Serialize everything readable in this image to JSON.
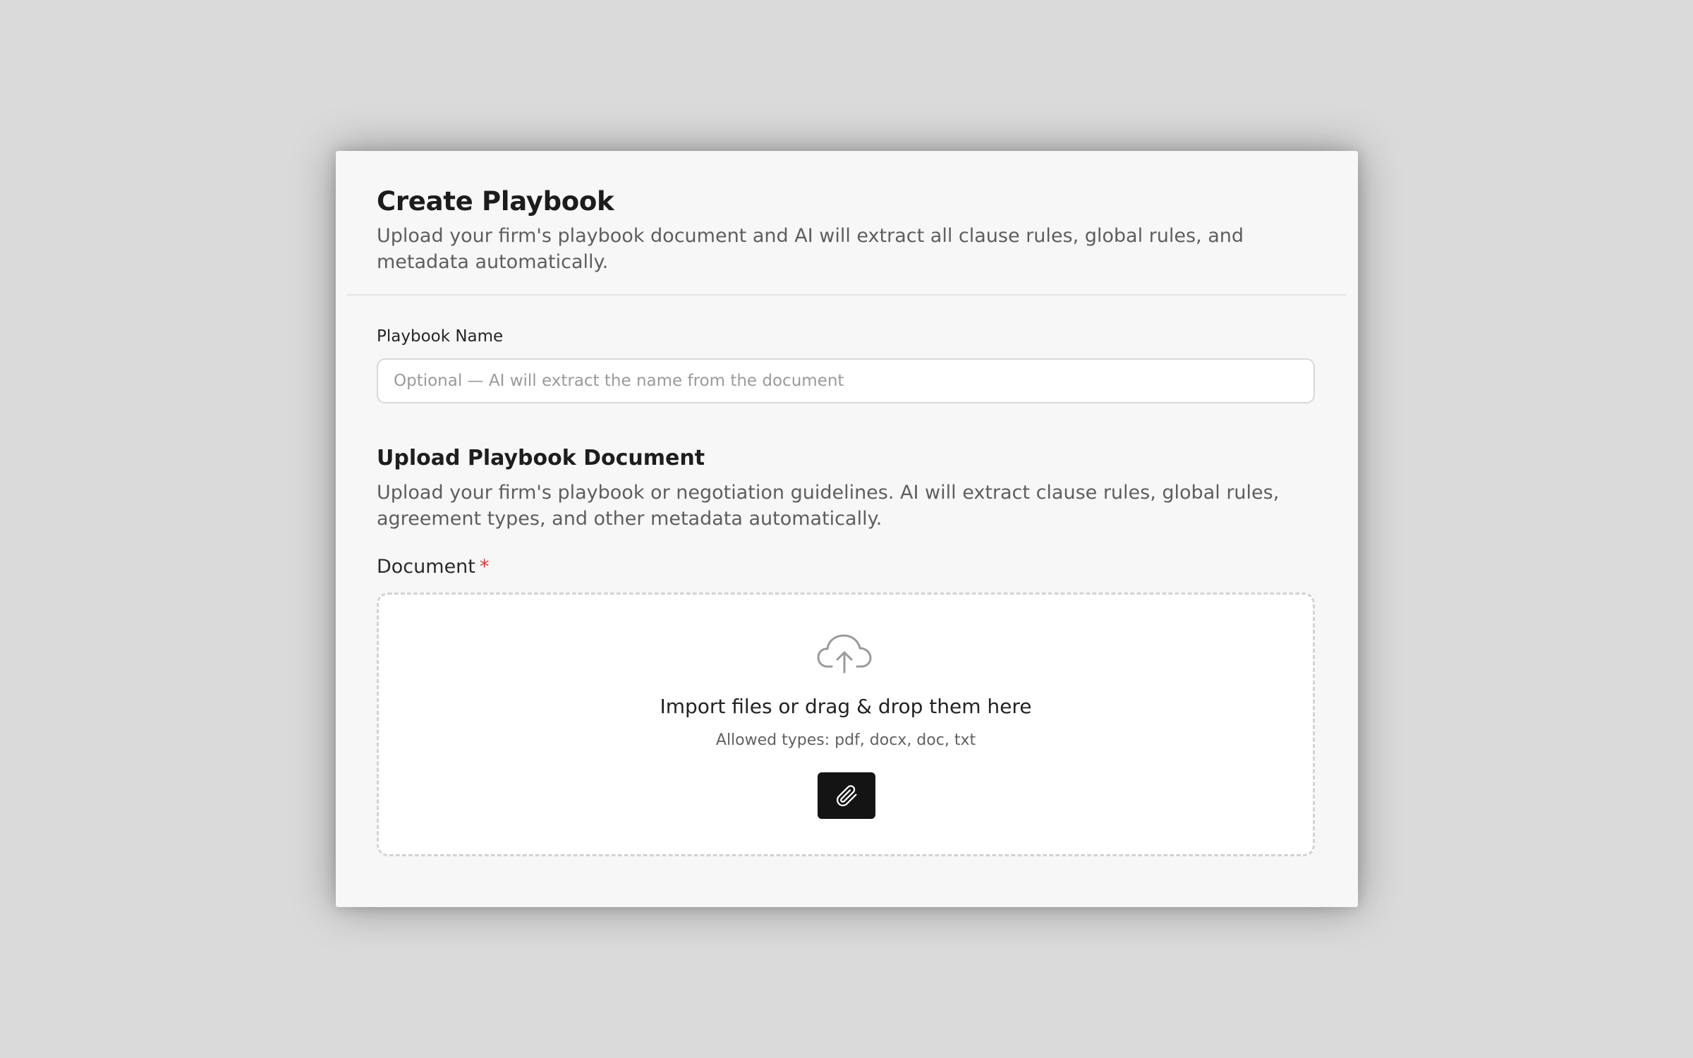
{
  "header": {
    "title": "Create Playbook",
    "subtitle": "Upload your firm's playbook document and AI will extract all clause rules, global rules, and metadata automatically."
  },
  "name_field": {
    "label": "Playbook Name",
    "value": "",
    "placeholder": "Optional — AI will extract the name from the document"
  },
  "upload_section": {
    "title": "Upload Playbook Document",
    "description": "Upload your firm's playbook or negotiation guidelines. AI will extract clause rules, global rules, agreement types, and other metadata automatically.",
    "document_label": "Document",
    "required_marker": "*"
  },
  "dropzone": {
    "icon": "cloud-upload-icon",
    "prompt": "Import files or drag & drop them here",
    "allowed_types": "Allowed types: pdf, docx, doc, txt",
    "attach_icon": "paperclip-icon"
  },
  "colors": {
    "background": "#dadada",
    "modal": "#f7f7f7",
    "button": "#141414",
    "required": "#d93838"
  }
}
